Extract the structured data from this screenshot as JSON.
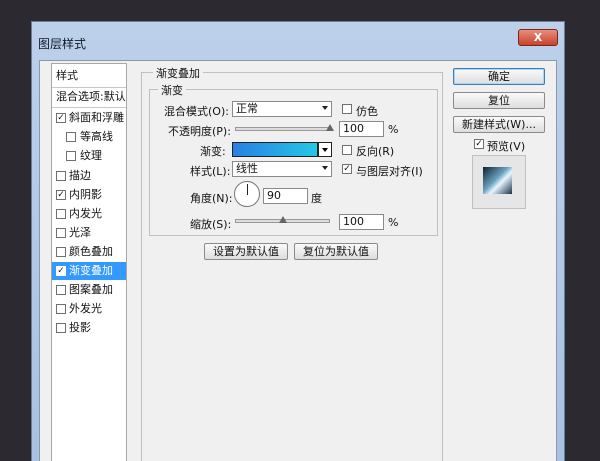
{
  "window": {
    "title": "图层样式",
    "close_label": "X"
  },
  "style_list": {
    "header": "样式",
    "blend_options": "混合选项:默认",
    "items": [
      {
        "label": "斜面和浮雕",
        "checked": true
      },
      {
        "label": "等高线",
        "checked": false,
        "indent": true
      },
      {
        "label": "纹理",
        "checked": false,
        "indent": true
      },
      {
        "label": "描边",
        "checked": false
      },
      {
        "label": "内阴影",
        "checked": true
      },
      {
        "label": "内发光",
        "checked": false
      },
      {
        "label": "光泽",
        "checked": false
      },
      {
        "label": "颜色叠加",
        "checked": false
      },
      {
        "label": "渐变叠加",
        "checked": true,
        "active": true
      },
      {
        "label": "图案叠加",
        "checked": false
      },
      {
        "label": "外发光",
        "checked": false
      },
      {
        "label": "投影",
        "checked": false
      }
    ]
  },
  "panel": {
    "title": "渐变叠加",
    "group_title": "渐变",
    "blend_mode_label": "混合模式(O):",
    "blend_mode_value": "正常",
    "dither_label": "仿色",
    "opacity_label": "不透明度(P):",
    "opacity_value": "100",
    "opacity_unit": "%",
    "opacity_level": 1.0,
    "gradient_label": "渐变:",
    "gradient_colors": [
      "#2a7fe4",
      "#24c7e6"
    ],
    "reverse_label": "反向(R)",
    "style_label": "样式(L):",
    "style_value": "线性",
    "align_label": "与图层对齐(I)",
    "angle_label": "角度(N):",
    "angle_value": "90",
    "angle_unit": "度",
    "scale_label": "缩放(S):",
    "scale_value": "100",
    "scale_unit": "%",
    "scale_level": 0.5,
    "set_default_label": "设置为默认值",
    "reset_default_label": "复位为默认值"
  },
  "buttons": {
    "ok": "确定",
    "reset": "复位",
    "new_style": "新建样式(W)...",
    "preview_label": "预览(V)"
  },
  "check_mark": "✓"
}
